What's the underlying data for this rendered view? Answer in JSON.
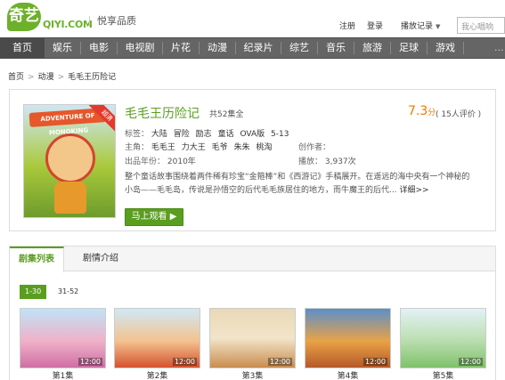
{
  "brand": {
    "logo_mark": "奇艺",
    "logo_small": "奇艺",
    "logo_text": "QIYI.COM",
    "slogan": "悦享品质"
  },
  "top_links": {
    "register": "注册",
    "login": "登录",
    "history": "播放记录"
  },
  "search": {
    "placeholder": "我心唱响"
  },
  "nav": {
    "items": [
      "首页",
      "娱乐",
      "电影",
      "电视剧",
      "片花",
      "动漫",
      "纪录片",
      "综艺",
      "音乐",
      "旅游",
      "足球",
      "游戏"
    ],
    "more": "..."
  },
  "breadcrumb": {
    "home": "首页",
    "category": "动漫",
    "current": "毛毛王历险记"
  },
  "show": {
    "title": "毛毛王历险记",
    "episode_count": "共52集全",
    "score": "7.3",
    "score_unit": "分",
    "rating_count": "( 15人评价 )",
    "tags_label": "标签：",
    "tags": [
      "大陆",
      "冒险",
      "励志",
      "童话",
      "OVA版",
      "5-13"
    ],
    "cast_label": "主角：",
    "cast": [
      "毛毛王",
      "力大王",
      "毛爷",
      "朱朱",
      "桃淘"
    ],
    "creator_label": "创作者：",
    "creator": "",
    "year_label": "出品年份：",
    "year": "2010年",
    "plays_label": "播放：",
    "plays": "3,937次",
    "description": "整个童话故事围绕着两件稀有珍宝“金箍棒”和《西游记》手稿展开。在遥远的海中央有一个神秘的小岛——毛毛岛，传说是孙悟空的后代毛毛族居住的地方，而牛魔王的后代...",
    "detail_link": "详细>>",
    "poster_title": "ADVENTURE OF MONOKING",
    "poster_badge": "超清",
    "watch_button": "马上观看"
  },
  "episodes": {
    "tabs": [
      "剧集列表",
      "剧情介绍"
    ],
    "ranges": [
      "1-30",
      "31-52"
    ],
    "items": [
      {
        "title": "第1集",
        "time": "12:00"
      },
      {
        "title": "第2集",
        "time": "12:00"
      },
      {
        "title": "第3集",
        "time": "12:00"
      },
      {
        "title": "第4集",
        "time": "12:00"
      },
      {
        "title": "第5集",
        "time": "12:00"
      }
    ]
  },
  "colors": {
    "brand_green": "#5a9e1f",
    "score_orange": "#f07800",
    "nav_bg": "#656565"
  }
}
